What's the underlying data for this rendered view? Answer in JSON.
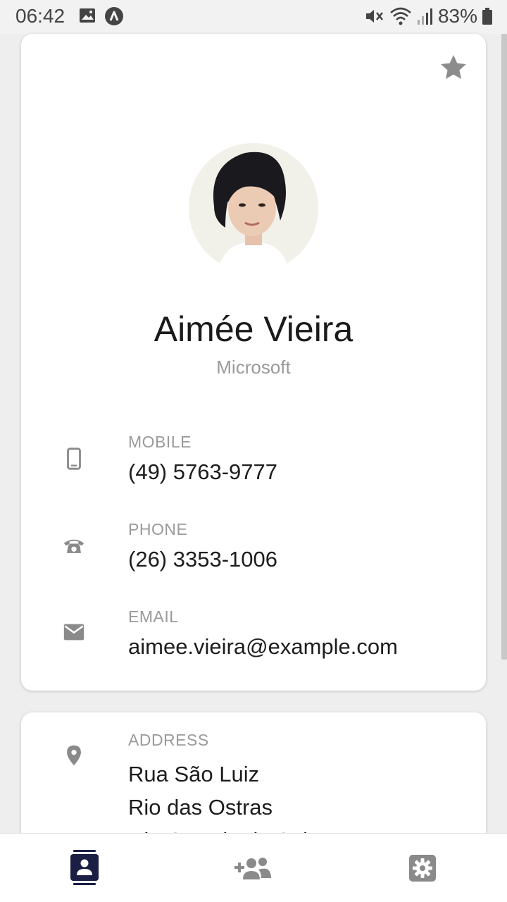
{
  "status_bar": {
    "time": "06:42",
    "battery_percent": "83%",
    "icons": [
      "gallery-icon",
      "a-badge-icon",
      "mute-icon",
      "wifi-icon",
      "signal-icon",
      "battery-icon"
    ]
  },
  "contact": {
    "name": "Aimée Vieira",
    "company": "Microsoft",
    "favorite": true,
    "fields": [
      {
        "label": "MOBILE",
        "value": "(49) 5763-9777",
        "icon": "smartphone-icon"
      },
      {
        "label": "PHONE",
        "value": "(26) 3353-1006",
        "icon": "telephone-icon"
      },
      {
        "label": "EMAIL",
        "value": "aimee.vieira@example.com",
        "icon": "mail-icon"
      }
    ],
    "address": {
      "label": "ADDRESS",
      "icon": "location-pin-icon",
      "lines": [
        "Rua São Luiz",
        "Rio das Ostras",
        "Rio Grande do Sul"
      ]
    }
  },
  "bottom_nav": {
    "items": [
      {
        "name": "contacts",
        "icon": "contact-card-icon",
        "active": true
      },
      {
        "name": "add-contact",
        "icon": "add-group-icon",
        "active": false
      },
      {
        "name": "settings",
        "icon": "gear-icon",
        "active": false
      }
    ]
  },
  "colors": {
    "accent": "#1c1f44",
    "icon_gray": "#8a8a8a",
    "label_gray": "#9a9a9a",
    "background": "#eeeeee"
  }
}
